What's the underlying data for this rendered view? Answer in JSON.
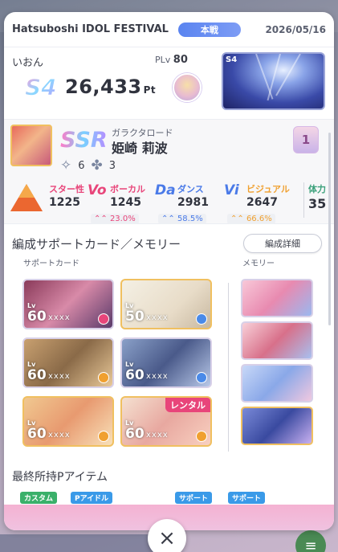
{
  "header": {
    "event_name": "Hatsuboshi IDOL FESTIVAL",
    "mode": "本戦",
    "date": "2026/05/16"
  },
  "producer": {
    "name": "いおん",
    "plv_label": "PLv",
    "plv_value": "80",
    "rank_badge": "S4",
    "points": "26,433",
    "points_unit": "Pt",
    "thumb_badge": "S4"
  },
  "idol": {
    "rarity": "SSR",
    "card_title": "ガラクタロード",
    "name": "姫崎 莉波",
    "stars": "6",
    "clovers": "3",
    "rank_emblem": "1",
    "stats": {
      "star_label": "スター性",
      "star_value": "1225",
      "vocal_label": "ボーカル",
      "vocal_value": "1245",
      "vocal_pct": "23.0%",
      "dance_label": "ダンス",
      "dance_value": "2981",
      "dance_pct": "58.5%",
      "visual_label": "ビジュアル",
      "visual_value": "2647",
      "visual_pct": "66.6%",
      "stamina_label": "体力",
      "stamina_value": "35"
    },
    "colors": {
      "vocal": "#e8457a",
      "dance": "#4a7ae8",
      "visual": "#f0a030"
    }
  },
  "formation": {
    "title": "編成サポートカード／メモリー",
    "detail_button": "編成詳細",
    "support_label": "サポートカード",
    "memory_label": "メモリー",
    "support_cards": [
      {
        "lv": "60",
        "dots": "xxxx",
        "rental": ""
      },
      {
        "lv": "50",
        "dots": "xxxx",
        "rental": ""
      },
      {
        "lv": "60",
        "dots": "xxxx",
        "rental": ""
      },
      {
        "lv": "60",
        "dots": "xxxx",
        "rental": ""
      },
      {
        "lv": "60",
        "dots": "xxxx",
        "rental": ""
      },
      {
        "lv": "60",
        "dots": "xxxx",
        "rental": "レンタル"
      }
    ],
    "lv_prefix": "Lv"
  },
  "items": {
    "title": "最終所持Pアイテム",
    "tags": [
      "カスタム",
      "Pアイドル",
      "サポート",
      "サポート"
    ]
  },
  "close_icon": "×"
}
